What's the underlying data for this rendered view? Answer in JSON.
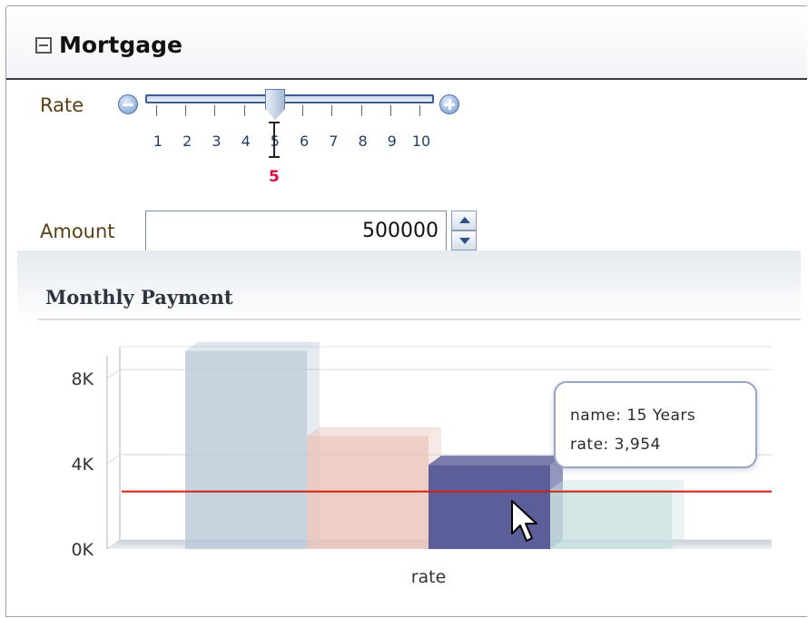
{
  "panel": {
    "title": "Mortgage"
  },
  "rate": {
    "label": "Rate",
    "ticks": [
      "1",
      "2",
      "3",
      "4",
      "5",
      "6",
      "7",
      "8",
      "9",
      "10"
    ],
    "value": "5",
    "min": 1,
    "max": 10
  },
  "amount": {
    "label": "Amount",
    "value": "500000"
  },
  "chart": {
    "title": "Monthly Payment"
  },
  "tooltip": {
    "line1": "name: 15 Years",
    "line2": "rate: 3,954"
  },
  "chart_data": {
    "type": "bar",
    "title": "Monthly Payment",
    "xlabel": "rate",
    "ylabel": "",
    "ylim": [
      0,
      9500
    ],
    "yticks": [
      "0K",
      "4K",
      "8K"
    ],
    "ytick_values": [
      0,
      4000,
      8000
    ],
    "values": [
      9300,
      5300,
      3954,
      2800
    ],
    "reference_line": 2700,
    "colors": [
      "#b8c7d7",
      "#e9c1b6",
      "#5c5e99",
      "#c5e0de"
    ],
    "line_color": "#d02010",
    "highlight": {
      "name": "15 Years",
      "value": 3954
    }
  }
}
